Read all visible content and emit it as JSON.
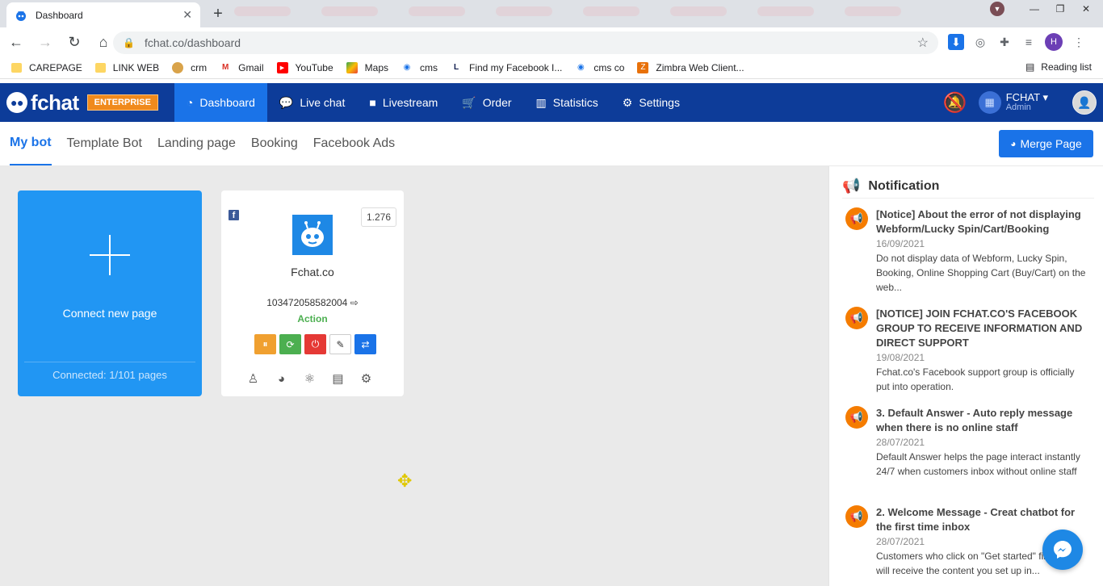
{
  "browser": {
    "tab_title": "Dashboard",
    "url": "fchat.co/dashboard",
    "bookmarks": [
      "CAREPAGE",
      "LINK WEB",
      "crm",
      "Gmail",
      "YouTube",
      "Maps",
      "cms",
      "Find my Facebook I...",
      "cms co",
      "Zimbra Web Client..."
    ],
    "reading_list": "Reading list",
    "profile_initial": "H"
  },
  "app": {
    "logo": "fchat",
    "edition": "ENTERPRISE",
    "nav": [
      "Dashboard",
      "Live chat",
      "Livestream",
      "Order",
      "Statistics",
      "Settings"
    ],
    "account_name": "FCHAT",
    "account_role": "Admin"
  },
  "subnav": {
    "tabs": [
      "My bot",
      "Template Bot",
      "Landing page",
      "Booking",
      "Facebook Ads"
    ],
    "merge_label": "Merge Page"
  },
  "connect_card": {
    "label": "Connect new page",
    "count": "Connected: 1/101 pages"
  },
  "page_card": {
    "count": "1.276",
    "name": "Fchat.co",
    "page_id": "103472058582004",
    "status": "Action"
  },
  "notifications": {
    "title": "Notification",
    "items": [
      {
        "title": "[Notice] About the error of not displaying Webform/Lucky Spin/Cart/Booking",
        "date": "16/09/2021",
        "body": "Do not display data of Webform, Lucky Spin, Booking, Online Shopping Cart (Buy/Cart) on the web..."
      },
      {
        "title": "[NOTICE] JOIN FCHAT.CO'S FACEBOOK GROUP TO RECEIVE INFORMATION AND DIRECT SUPPORT",
        "date": "19/08/2021",
        "body": "Fchat.co's Facebook support group is officially put into operation."
      },
      {
        "title": "3. Default Answer - Auto reply message when there is no online staff",
        "date": "28/07/2021",
        "body": "Default Answer helps the page interact instantly 24/7 when customers inbox without online staff"
      },
      {
        "title": "2. Welcome Message - Creat chatbot for the first time inbox",
        "date": "28/07/2021",
        "body": "Customers who click on \"Get started\" first inbox will receive the content you set up in..."
      }
    ]
  },
  "colors": {
    "appbar": "#0d3c99",
    "accent": "#1a73e8",
    "connect_card": "#2196f3",
    "notice": "#f57c00"
  }
}
